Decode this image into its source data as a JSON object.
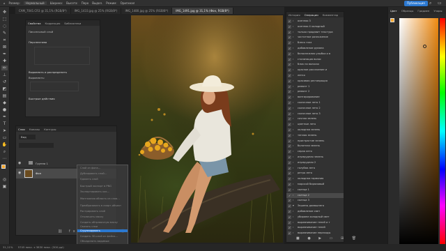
{
  "topbar": {
    "items": [
      "Размер:",
      "Нормальный",
      "Ширина:",
      "Высота:",
      "Перо",
      "Выдел.",
      "Режим:",
      "Оригинал"
    ],
    "publish_button": "Публикация"
  },
  "tabs": [
    "CAM_7041.CR3 @ 31,1% (RGB/8*)",
    "IMG_1433.jpg @ 25% (RGB/8*)",
    "IMG_1480.jpg @ 25% (RGB/8*)",
    "IMG_1491.jpg @ 31,1% (Фон, RGB/8*)"
  ],
  "properties": {
    "tabs": [
      "Свойства",
      "Коррекция",
      "Библиотеки"
    ],
    "layer_kind": "Пиксельный слой",
    "section_transform": "Перспектива",
    "section_align": "Выровнять и распределить",
    "align_label": "Выровнять:",
    "section_quick": "Быстрые действия"
  },
  "layers": {
    "tabs": [
      "Слои",
      "Каналы",
      "Контуры"
    ],
    "filter_kind": "Вид",
    "group_name": "Группа 1",
    "bg_name": "Фон"
  },
  "context_menu": {
    "items": [
      "Слой из фона...",
      "Дублировать слой...",
      "Удалить слой",
      "Быстрый экспорт в PNG",
      "Экспортировать как...",
      "Монтажная область из слоя...",
      "Преобразовать в смарт-объект",
      "Растрировать слой",
      "Отключить маску",
      "Создать обтравочную маску",
      "Связать слои",
      "Выделить связанные слои"
    ],
    "highlighted": "Сгруппировать",
    "bottom_items": [
      "Создать 3D-слой из файла...",
      "Объединить видимые"
    ]
  },
  "history": {
    "tabs": [
      "История",
      "Операции",
      "Комментар"
    ],
    "rows": [
      "осенняя 3",
      "осенняя 4 холодный",
      "только продавит текстура",
      "частотное разложение",
      "блеск глаз",
      "добавление румяна",
      "белоснежная улыбка и в",
      "стилизация волос",
      "блик на волосах",
      "красное расслоение и ",
      "легко",
      "красивая реставрация",
      "ремонт 1",
      "ремонт 2",
      "винтирирование",
      "сказочное лето 1",
      "сказочное лето 2",
      "сказочное лето 3",
      "сочная зелень",
      "цветные лето",
      "холодная зелень",
      "теплая зелень",
      "пристрастие зелень",
      "болотная зелень",
      "серая лето",
      "изумрудная зелень",
      "изумрудная 2",
      "голубая лето",
      "ретро лето",
      "холодная гармония",
      "морской бирюзовый",
      "солнца 1",
      "солнца 2",
      "солнца 3",
      "Экшены домашнего",
      "добавление свет",
      "убираем холодный свет",
      "выравнивание теней и т",
      "выравнивание теней",
      "выравнивание переходы"
    ],
    "folder_row_index": 34,
    "highlighted_row_index": 32
  },
  "right_panel": {
    "tabs": [
      "Цвет",
      "Образцы",
      "Градиен",
      "Узоры"
    ],
    "accent": "#f4a52a"
  },
  "status": {
    "zoom": "31,11%",
    "doc": "5745 пикс. x 3830 пикс. (300 ppi)"
  }
}
